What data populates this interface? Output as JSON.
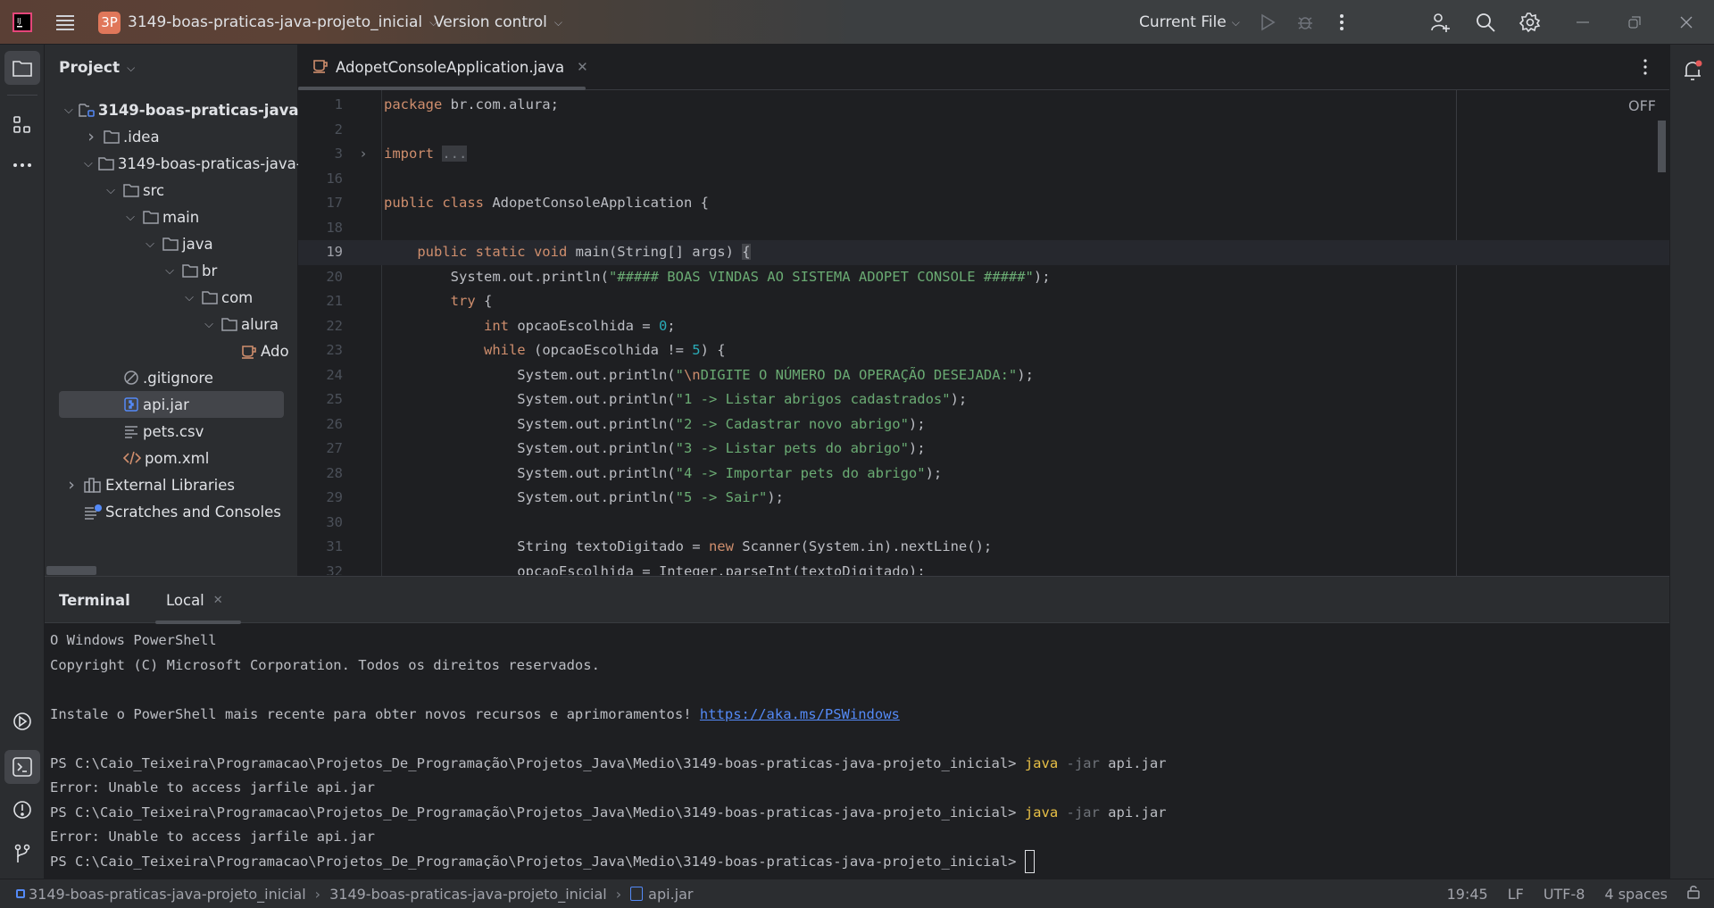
{
  "titlebar": {
    "project_badge": "3P",
    "project_name": "3149-boas-praticas-java-projeto_inicial",
    "vcs": "Version control",
    "run_config": "Current File",
    "badge_color": "#e0775a"
  },
  "project_panel": {
    "title": "Project",
    "items": [
      {
        "label": "3149-boas-praticas-java-",
        "icon": "module-folder-icon",
        "indent": 0,
        "chevron": "down",
        "bold": true
      },
      {
        "label": ".idea",
        "icon": "folder-icon",
        "indent": 1,
        "chevron": "right"
      },
      {
        "label": "3149-boas-praticas-java-",
        "icon": "folder-icon",
        "indent": 1,
        "chevron": "down"
      },
      {
        "label": "src",
        "icon": "folder-icon",
        "indent": 2,
        "chevron": "down"
      },
      {
        "label": "main",
        "icon": "folder-icon",
        "indent": 3,
        "chevron": "down"
      },
      {
        "label": "java",
        "icon": "folder-icon",
        "indent": 4,
        "chevron": "down"
      },
      {
        "label": "br",
        "icon": "folder-icon",
        "indent": 5,
        "chevron": "down"
      },
      {
        "label": "com",
        "icon": "folder-icon",
        "indent": 6,
        "chevron": "down"
      },
      {
        "label": "alura",
        "icon": "folder-icon",
        "indent": 7,
        "chevron": "down"
      },
      {
        "label": "Ado",
        "icon": "java-class-icon",
        "indent": 8,
        "chevron": ""
      },
      {
        "label": ".gitignore",
        "icon": "ignore-file-icon",
        "indent": 2,
        "chevron": ""
      },
      {
        "label": "api.jar",
        "icon": "jar-icon",
        "indent": 2,
        "chevron": "",
        "selected": true
      },
      {
        "label": "pets.csv",
        "icon": "text-file-icon",
        "indent": 2,
        "chevron": ""
      },
      {
        "label": "pom.xml",
        "icon": "xml-icon",
        "indent": 2,
        "chevron": ""
      },
      {
        "label": "External Libraries",
        "icon": "libraries-icon",
        "indent": 0,
        "chevron": "right"
      },
      {
        "label": "Scratches and Consoles",
        "icon": "scratches-icon",
        "indent": 0,
        "chevron": ""
      }
    ]
  },
  "editor": {
    "tab": "AdopetConsoleApplication.java",
    "inspection": "OFF",
    "current_line": "19",
    "lines": [
      {
        "n": "1",
        "t": [
          [
            "kw",
            "package "
          ],
          [
            "",
            "br.com.alura;"
          ]
        ]
      },
      {
        "n": "2",
        "t": []
      },
      {
        "n": "3",
        "t": [
          [
            "kw",
            "import "
          ],
          [
            "fold",
            "..."
          ]
        ],
        "folded": true
      },
      {
        "n": "16",
        "t": []
      },
      {
        "n": "17",
        "t": [
          [
            "kw",
            "public class "
          ],
          [
            "",
            "AdopetConsoleApplication {"
          ]
        ]
      },
      {
        "n": "18",
        "t": []
      },
      {
        "n": "19",
        "t": [
          [
            "kw",
            "    public static void "
          ],
          [
            "",
            "main(String[] args) "
          ],
          [
            "brace",
            "{"
          ]
        ]
      },
      {
        "n": "20",
        "t": [
          [
            "",
            "        System.out.println("
          ],
          [
            "str",
            "\"##### BOAS VINDAS AO SISTEMA ADOPET CONSOLE #####\""
          ],
          [
            "",
            ");"
          ]
        ]
      },
      {
        "n": "21",
        "t": [
          [
            "kw",
            "        try "
          ],
          [
            "",
            "{"
          ]
        ]
      },
      {
        "n": "22",
        "t": [
          [
            "kw",
            "            int "
          ],
          [
            "",
            "opcaoEscolhida = "
          ],
          [
            "num",
            "0"
          ],
          [
            "",
            ";"
          ]
        ]
      },
      {
        "n": "23",
        "t": [
          [
            "kw",
            "            while "
          ],
          [
            "",
            "(opcaoEscolhida != "
          ],
          [
            "num",
            "5"
          ],
          [
            "",
            ") {"
          ]
        ]
      },
      {
        "n": "24",
        "t": [
          [
            "",
            "                System.out.println("
          ],
          [
            "str",
            "\""
          ],
          [
            "esc",
            "\\n"
          ],
          [
            "str",
            "DIGITE O NÚMERO DA OPERAÇÃO DESEJADA:\""
          ],
          [
            "",
            ");"
          ]
        ]
      },
      {
        "n": "25",
        "t": [
          [
            "",
            "                System.out.println("
          ],
          [
            "str",
            "\"1 -> Listar abrigos cadastrados\""
          ],
          [
            "",
            ");"
          ]
        ]
      },
      {
        "n": "26",
        "t": [
          [
            "",
            "                System.out.println("
          ],
          [
            "str",
            "\"2 -> Cadastrar novo abrigo\""
          ],
          [
            "",
            ");"
          ]
        ]
      },
      {
        "n": "27",
        "t": [
          [
            "",
            "                System.out.println("
          ],
          [
            "str",
            "\"3 -> Listar pets do abrigo\""
          ],
          [
            "",
            ");"
          ]
        ]
      },
      {
        "n": "28",
        "t": [
          [
            "",
            "                System.out.println("
          ],
          [
            "str",
            "\"4 -> Importar pets do abrigo\""
          ],
          [
            "",
            ");"
          ]
        ]
      },
      {
        "n": "29",
        "t": [
          [
            "",
            "                System.out.println("
          ],
          [
            "str",
            "\"5 -> Sair\""
          ],
          [
            "",
            ");"
          ]
        ]
      },
      {
        "n": "30",
        "t": []
      },
      {
        "n": "31",
        "t": [
          [
            "",
            "                String textoDigitado = "
          ],
          [
            "kw",
            "new "
          ],
          [
            "",
            "Scanner(System.in).nextLine();"
          ]
        ]
      },
      {
        "n": "32",
        "t": [
          [
            "",
            "                opcaoEscolhida = Integer.parseInt(textoDigitado);"
          ]
        ]
      }
    ]
  },
  "terminal": {
    "title": "Terminal",
    "tab": "Local",
    "lines": [
      [
        [
          "",
          "O Windows PowerShell"
        ]
      ],
      [
        [
          "",
          "Copyright (C) Microsoft Corporation. Todos os direitos reservados."
        ]
      ],
      [],
      [
        [
          "",
          "Instale o PowerShell mais recente para obter novos recursos e aprimoramentos! "
        ],
        [
          "link",
          "https://aka.ms/PSWindows"
        ]
      ],
      [],
      [
        [
          "",
          "PS C:\\Caio_Teixeira\\Programacao\\Projetos_De_Programação\\Projetos_Java\\Medio\\3149-boas-praticas-java-projeto_inicial> "
        ],
        [
          "yel",
          "java"
        ],
        [
          "dim",
          " -jar"
        ],
        [
          "",
          " api.jar"
        ]
      ],
      [
        [
          "",
          "Error: Unable to access jarfile api.jar"
        ]
      ],
      [
        [
          "",
          "PS C:\\Caio_Teixeira\\Programacao\\Projetos_De_Programação\\Projetos_Java\\Medio\\3149-boas-praticas-java-projeto_inicial> "
        ],
        [
          "yel",
          "java"
        ],
        [
          "dim",
          " -jar"
        ],
        [
          "",
          " api.jar"
        ]
      ],
      [
        [
          "",
          "Error: Unable to access jarfile api.jar"
        ]
      ],
      [
        [
          "",
          "PS C:\\Caio_Teixeira\\Programacao\\Projetos_De_Programação\\Projetos_Java\\Medio\\3149-boas-praticas-java-projeto_inicial> "
        ]
      ]
    ]
  },
  "statusbar": {
    "breadcrumb": [
      "3149-boas-praticas-java-projeto_inicial",
      "3149-boas-praticas-java-projeto_inicial",
      "api.jar"
    ],
    "position": "19:45",
    "line_sep": "LF",
    "encoding": "UTF-8",
    "indent": "4 spaces"
  }
}
